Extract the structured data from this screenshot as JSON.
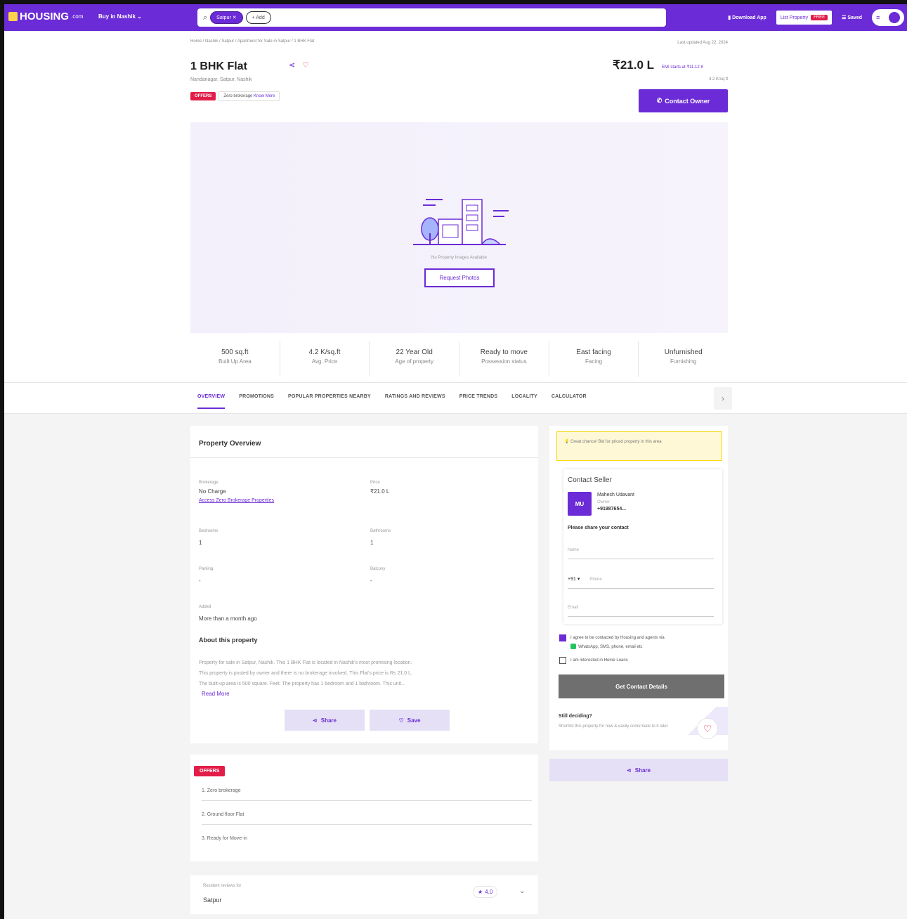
{
  "topbar": {
    "brand": "HOUSING",
    "brand_suffix": ".com",
    "buy_in": "Buy in Nashik",
    "search_chip": "Satpur ✕",
    "search_more": "+ Add",
    "download_app": "Download App",
    "list_property": "List Property",
    "free_badge": "FREE",
    "saved": "Saved"
  },
  "breadcrumb": "Home / Nashik / Satpur / Apartment for Sale in Satpur / 1 BHK Flat",
  "updated": "Last updated Aug 22, 2024",
  "header": {
    "title": "1 BHK Flat",
    "location": "Nandanagar, Satpur, Nashik",
    "offers_badge": "OFFERS",
    "zero_brokerage": "Zero brokerage",
    "know_more": "Know More",
    "price": "₹21.0 L",
    "emi": "EMI starts at ₹11.12 K",
    "price_per_sqft": "4.2 K/sq.ft",
    "contact_owner": "Contact Owner"
  },
  "hero": {
    "no_images": "No Property Images Available",
    "request_photos": "Request Photos"
  },
  "stats": [
    {
      "value": "500 sq.ft",
      "label": "Built Up Area"
    },
    {
      "value": "4.2 K/sq.ft",
      "label": "Avg. Price"
    },
    {
      "value": "22 Year Old",
      "label": "Age of property"
    },
    {
      "value": "Ready to move",
      "label": "Possession status"
    },
    {
      "value": "East facing",
      "label": "Facing"
    },
    {
      "value": "Unfurnished",
      "label": "Furnishing"
    }
  ],
  "tabs": [
    "OVERVIEW",
    "PROMOTIONS",
    "POPULAR PROPERTIES NEARBY",
    "RATINGS AND REVIEWS",
    "PRICE TRENDS",
    "LOCALITY",
    "CALCULATOR"
  ],
  "overview": {
    "heading": "Property Overview",
    "brokerage_k": "Brokerage",
    "brokerage_v": "No Charge",
    "brokerage_link": "Access Zero Brokerage Properties",
    "price_k": "Price",
    "price_v": "₹21.0 L",
    "bedrooms_k": "Bedrooms",
    "bedrooms_v": "1",
    "bathrooms_k": "Bathrooms",
    "bathrooms_v": "1",
    "parking_k": "Parking",
    "parking_v": "-",
    "balcony_k": "Balcony",
    "balcony_v": "-",
    "added_k": "Added",
    "added_v": "More than a month ago",
    "about_h": "About this property",
    "about_1": "Property for sale in Satpur, Nashik. This 1 BHK Flat is located in Nashik's most promising location.",
    "about_2": "This property is posted by owner and there is no brokerage involved. This Flat's price is Rs 21.0 L.",
    "about_3": "The built-up area is 500 square. Feet. The property has 1 bedroom and 1 bathroom. This unit...",
    "read_more": "Read More",
    "share": "Share",
    "save": "Save"
  },
  "offers": {
    "tag": "OFFERS",
    "items": [
      "1. Zero brokerage",
      "2. Ground floor Flat",
      "3. Ready for Move-in"
    ]
  },
  "review": {
    "label": "Resident reviews for",
    "locality": "Satpur",
    "rating": "4.0"
  },
  "seller": {
    "tip": "Great chance! Bid for priced property in this area",
    "heading": "Contact Seller",
    "initials": "MU",
    "name": "Mahesh Udavant",
    "role": "Owner",
    "phone": "+91987654...",
    "share_details": "Please share your contact",
    "name_placeholder": "Name",
    "country_code": "+91 ▾",
    "phone_placeholder": "Phone",
    "email_placeholder": "Email",
    "agree": "I agree to be contacted by Housing and agents via",
    "agree_channels": "WhatsApp, SMS, phone, email etc",
    "home_loans": "I am interested in Home Loans",
    "get_contact": "Get Contact Details",
    "still_h": "Still deciding?",
    "still_p": "Shortlist this property for now & easily come back to it later",
    "share": "Share"
  },
  "colors": {
    "brand_purple": "#6b2bd6",
    "offer_red": "#e11d48"
  }
}
